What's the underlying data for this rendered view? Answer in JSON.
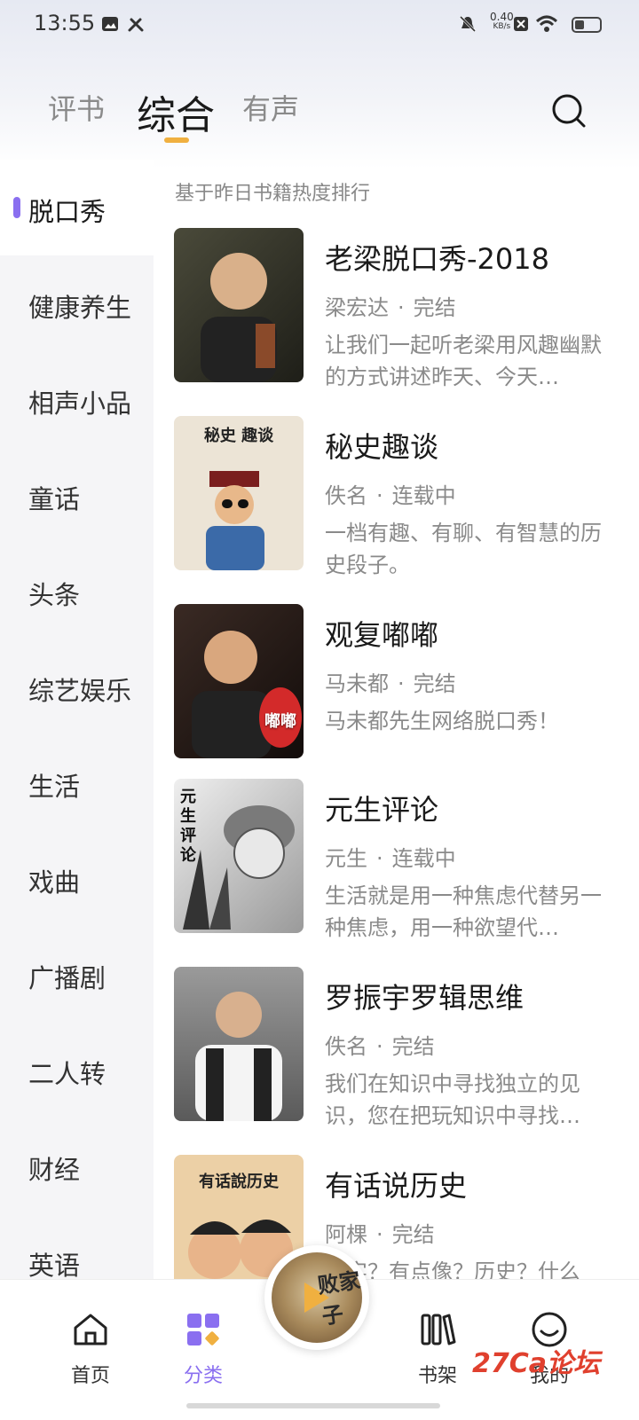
{
  "status_bar": {
    "time": "13:55",
    "speed_value": "0.40",
    "speed_unit": "KB/s",
    "icons": [
      "image-icon",
      "tools-icon",
      "mute-icon",
      "close-box-icon",
      "wifi-icon",
      "battery-icon"
    ]
  },
  "header": {
    "tabs": [
      {
        "label": "评书",
        "active": false
      },
      {
        "label": "综合",
        "active": true
      },
      {
        "label": "有声",
        "active": false
      }
    ],
    "accent_color": "#f0b040"
  },
  "sidebar": {
    "active_color": "#8a6ff0",
    "items": [
      {
        "label": "脱口秀",
        "active": true
      },
      {
        "label": "健康养生"
      },
      {
        "label": "相声小品"
      },
      {
        "label": "童话"
      },
      {
        "label": "头条"
      },
      {
        "label": "综艺娱乐"
      },
      {
        "label": "生活"
      },
      {
        "label": "戏曲"
      },
      {
        "label": "广播剧"
      },
      {
        "label": "二人转"
      },
      {
        "label": "财经"
      },
      {
        "label": "英语"
      }
    ]
  },
  "main": {
    "subtitle": "基于昨日书籍热度排行",
    "books": [
      {
        "title": "老梁脱口秀-2018",
        "author": "梁宏达",
        "status": "完结",
        "desc": "让我们一起听老梁用风趣幽默的方式讲述昨天、今天…",
        "cover_color": "#3a3a2e",
        "cover_text": ""
      },
      {
        "title": "秘史趣谈",
        "author": "佚名",
        "status": "连载中",
        "desc": "一档有趣、有聊、有智慧的历史段子。",
        "cover_color": "#e8e0d2",
        "cover_text": "秘史 趣谈"
      },
      {
        "title": "观复嘟嘟",
        "author": "马未都",
        "status": "完结",
        "desc": "马未都先生网络脱口秀！",
        "cover_color": "#2a1e1a",
        "cover_text": "嘟嘟"
      },
      {
        "title": "元生评论",
        "author": "元生",
        "status": "连载中",
        "desc": "生活就是用一种焦虑代替另一种焦虑，用一种欲望代…",
        "cover_color": "#d0d0d0",
        "cover_text": "元生评论"
      },
      {
        "title": "罗振宇罗辑思维",
        "author": "佚名",
        "status": "完结",
        "desc": "我们在知识中寻找独立的见识，您在把玩知识中寻找…",
        "cover_color": "#8a8a8a",
        "cover_text": ""
      },
      {
        "title": "有话说历史",
        "author": "阿棵",
        "status": "完结",
        "desc": "真实？有点像？历史？什么",
        "cover_color": "#e6c9a0",
        "cover_text": "有话說历史"
      }
    ]
  },
  "bottom_nav": {
    "items": [
      {
        "label": "首页",
        "icon": "home-icon",
        "active": false
      },
      {
        "label": "分类",
        "icon": "category-icon",
        "active": true
      },
      {
        "label": "书架",
        "icon": "bookshelf-icon",
        "active": false
      },
      {
        "label": "我的",
        "icon": "smile-icon",
        "active": false
      }
    ],
    "player_sticker": "败家子"
  },
  "watermark": "27Ca论坛"
}
